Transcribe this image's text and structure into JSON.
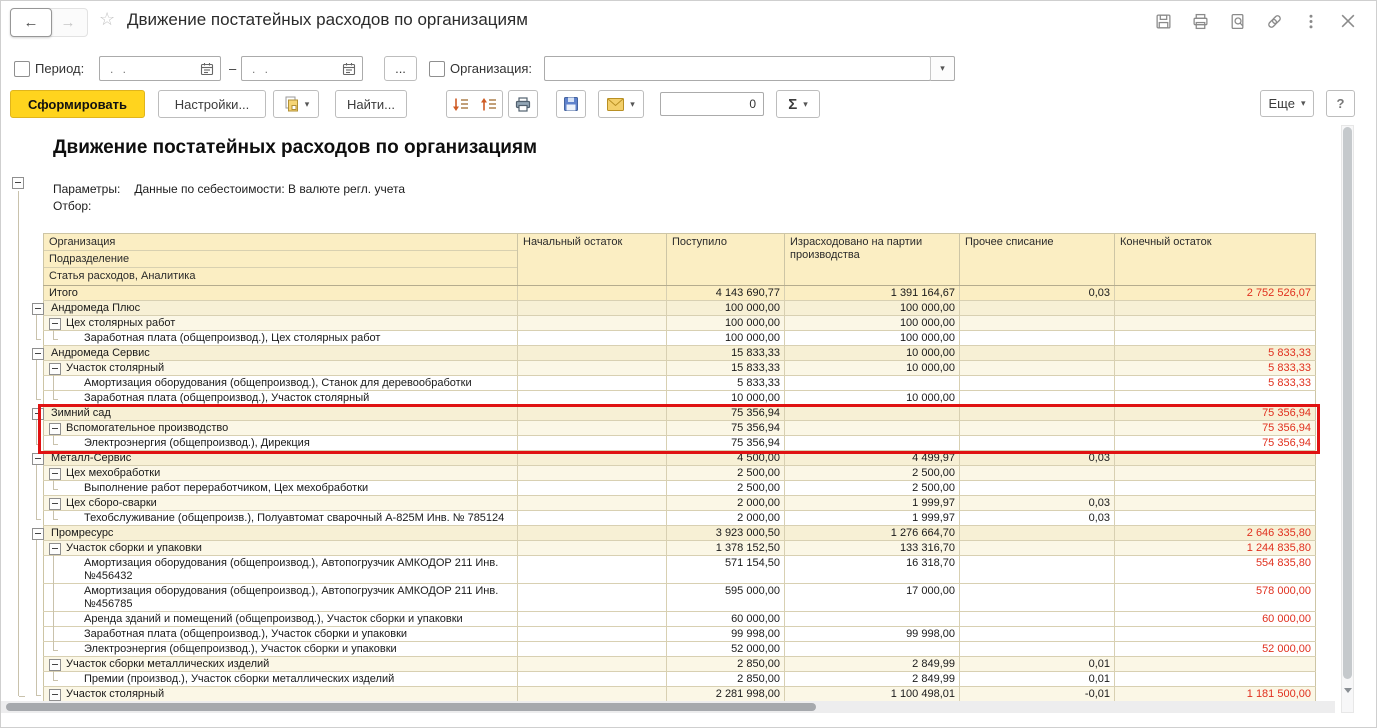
{
  "titlebar": {
    "title": "Движение постатейных расходов по организациям",
    "back_arrow": "←",
    "forward_arrow": "→",
    "star": "☆"
  },
  "filters": {
    "period_label": "Период:",
    "date_from_value": ". .",
    "date_to_value": ". .",
    "range_separator": "–",
    "more_button_label": "...",
    "organization_label": "Организация:",
    "organization_value": ""
  },
  "toolbar": {
    "generate_label": "Сформировать",
    "settings_label": "Настройки...",
    "find_label": "Найти...",
    "counter_value": "0",
    "sigma_label": "Σ",
    "more_label": "Еще",
    "help_label": "?",
    "caret": "▾"
  },
  "report": {
    "title": "Движение постатейных расходов по организациям",
    "params_label": "Параметры:",
    "params_value": "Данные по себестоимости: В валюте регл. учета",
    "filter_label": "Отбор:"
  },
  "table": {
    "name_header_lines": [
      "Организация",
      "Подразделение",
      "Статья расходов, Аналитика"
    ],
    "value_headers": [
      "Начальный остаток",
      "Поступило",
      "Израсходовано на партии производства",
      "Прочее списание",
      "Конечный остаток"
    ],
    "rows": [
      {
        "label": "Итого",
        "level": 0,
        "expand": false,
        "highlight": false,
        "values": [
          "",
          "4 143 690,77",
          "1 391 164,67",
          "0,03",
          "2 752 526,07"
        ]
      },
      {
        "label": "Андромеда Плюс",
        "level": 1,
        "expand": true,
        "highlight": false,
        "values": [
          "",
          "100 000,00",
          "100 000,00",
          "",
          ""
        ]
      },
      {
        "label": "Цех столярных работ",
        "level": 2,
        "expand": true,
        "highlight": false,
        "values": [
          "",
          "100 000,00",
          "100 000,00",
          "",
          ""
        ]
      },
      {
        "label": "Заработная плата (общепроизвод.), Цех столярных работ",
        "level": 3,
        "expand": false,
        "highlight": false,
        "values": [
          "",
          "100 000,00",
          "100 000,00",
          "",
          ""
        ]
      },
      {
        "label": "Андромеда Сервис",
        "level": 1,
        "expand": true,
        "highlight": false,
        "values": [
          "",
          "15 833,33",
          "10 000,00",
          "",
          "5 833,33"
        ]
      },
      {
        "label": "Участок столярный",
        "level": 2,
        "expand": true,
        "highlight": false,
        "values": [
          "",
          "15 833,33",
          "10 000,00",
          "",
          "5 833,33"
        ]
      },
      {
        "label": "Амортизация оборудования (общепроизвод.), Станок для деревообработки",
        "level": 3,
        "expand": false,
        "highlight": false,
        "values": [
          "",
          "5 833,33",
          "",
          "",
          "5 833,33"
        ]
      },
      {
        "label": "Заработная плата (общепроизвод.), Участок столярный",
        "level": 3,
        "expand": false,
        "highlight": false,
        "values": [
          "",
          "10 000,00",
          "10 000,00",
          "",
          ""
        ]
      },
      {
        "label": "Зимний сад",
        "level": 1,
        "expand": true,
        "highlight": true,
        "values": [
          "",
          "75 356,94",
          "",
          "",
          "75 356,94"
        ]
      },
      {
        "label": "Вспомогательное производство",
        "level": 2,
        "expand": true,
        "highlight": true,
        "values": [
          "",
          "75 356,94",
          "",
          "",
          "75 356,94"
        ]
      },
      {
        "label": "Электроэнергия (общепроизвод.), Дирекция",
        "level": 3,
        "expand": false,
        "highlight": true,
        "values": [
          "",
          "75 356,94",
          "",
          "",
          "75 356,94"
        ]
      },
      {
        "label": "Металл-Сервис",
        "level": 1,
        "expand": true,
        "highlight": false,
        "values": [
          "",
          "4 500,00",
          "4 499,97",
          "0,03",
          ""
        ]
      },
      {
        "label": "Цех мехобработки",
        "level": 2,
        "expand": true,
        "highlight": false,
        "values": [
          "",
          "2 500,00",
          "2 500,00",
          "",
          ""
        ]
      },
      {
        "label": "Выполнение работ переработчиком, Цех мехобработки",
        "level": 3,
        "expand": false,
        "highlight": false,
        "values": [
          "",
          "2 500,00",
          "2 500,00",
          "",
          ""
        ]
      },
      {
        "label": "Цех сборо-сварки",
        "level": 2,
        "expand": true,
        "highlight": false,
        "values": [
          "",
          "2 000,00",
          "1 999,97",
          "0,03",
          ""
        ]
      },
      {
        "label": "Техобслуживание (общепроизв.), Полуавтомат сварочный А-825М Инв. № 785124",
        "level": 3,
        "expand": false,
        "highlight": false,
        "values": [
          "",
          "2 000,00",
          "1 999,97",
          "0,03",
          ""
        ]
      },
      {
        "label": "Промресурс",
        "level": 1,
        "expand": true,
        "highlight": false,
        "values": [
          "",
          "3 923 000,50",
          "1 276 664,70",
          "",
          "2 646 335,80"
        ]
      },
      {
        "label": "Участок сборки и упаковки",
        "level": 2,
        "expand": true,
        "highlight": false,
        "values": [
          "",
          "1 378 152,50",
          "133 316,70",
          "",
          "1 244 835,80"
        ]
      },
      {
        "label": "Амортизация оборудования (общепроизвод.), Автопогрузчик АМКОДОР 211 Инв. №456432",
        "level": 3,
        "expand": false,
        "highlight": false,
        "values": [
          "",
          "571 154,50",
          "16 318,70",
          "",
          "554 835,80"
        ]
      },
      {
        "label": "Амортизация оборудования (общепроизвод.), Автопогрузчик АМКОДОР 211 Инв. №456785",
        "level": 3,
        "expand": false,
        "highlight": false,
        "values": [
          "",
          "595 000,00",
          "17 000,00",
          "",
          "578 000,00"
        ]
      },
      {
        "label": "Аренда зданий и помещений (общепроизвод.), Участок сборки и упаковки",
        "level": 3,
        "expand": false,
        "highlight": false,
        "values": [
          "",
          "60 000,00",
          "",
          "",
          "60 000,00"
        ]
      },
      {
        "label": "Заработная плата (общепроизвод.), Участок сборки и упаковки",
        "level": 3,
        "expand": false,
        "highlight": false,
        "values": [
          "",
          "99 998,00",
          "99 998,00",
          "",
          ""
        ]
      },
      {
        "label": "Электроэнергия (общепроизвод.), Участок сборки и упаковки",
        "level": 3,
        "expand": false,
        "highlight": false,
        "values": [
          "",
          "52 000,00",
          "",
          "",
          "52 000,00"
        ]
      },
      {
        "label": "Участок сборки металлических изделий",
        "level": 2,
        "expand": true,
        "highlight": false,
        "values": [
          "",
          "2 850,00",
          "2 849,99",
          "0,01",
          ""
        ]
      },
      {
        "label": "Премии (производ.), Участок сборки металлических изделий",
        "level": 3,
        "expand": false,
        "highlight": false,
        "values": [
          "",
          "2 850,00",
          "2 849,99",
          "0,01",
          ""
        ]
      },
      {
        "label": "Участок столярный",
        "level": 2,
        "expand": true,
        "highlight": false,
        "values": [
          "",
          "2 281 998,00",
          "1 100 498,01",
          "-0,01",
          "1 181 500,00"
        ]
      }
    ]
  },
  "colors": {
    "accent_button": "#ffd41e",
    "negative_value": "#e0301e",
    "highlight_border": "#e01212",
    "header_fill": "#fbeec3"
  }
}
